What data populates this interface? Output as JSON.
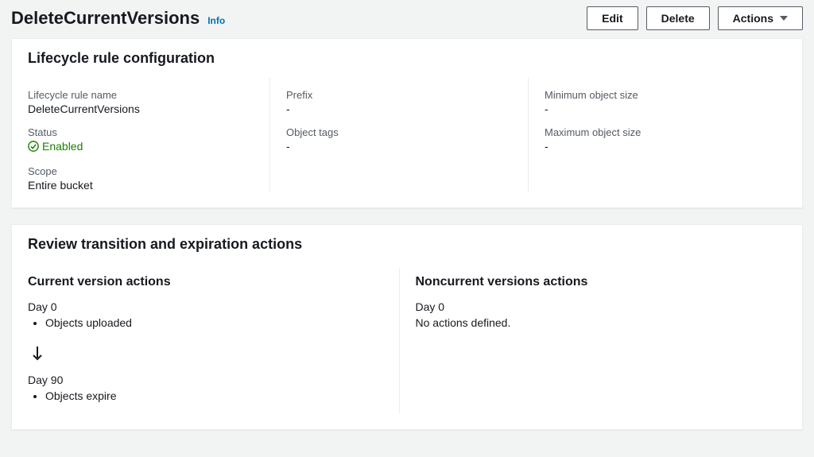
{
  "header": {
    "title": "DeleteCurrentVersions",
    "info": "Info",
    "buttons": {
      "edit": "Edit",
      "delete": "Delete",
      "actions": "Actions"
    }
  },
  "config": {
    "panel_title": "Lifecycle rule configuration",
    "col1": {
      "rule_name_label": "Lifecycle rule name",
      "rule_name_value": "DeleteCurrentVersions",
      "status_label": "Status",
      "status_value": "Enabled",
      "scope_label": "Scope",
      "scope_value": "Entire bucket"
    },
    "col2": {
      "prefix_label": "Prefix",
      "prefix_value": "-",
      "tags_label": "Object tags",
      "tags_value": "-"
    },
    "col3": {
      "min_label": "Minimum object size",
      "min_value": "-",
      "max_label": "Maximum object size",
      "max_value": "-"
    }
  },
  "review": {
    "panel_title": "Review transition and expiration actions",
    "current": {
      "heading": "Current version actions",
      "day0_label": "Day 0",
      "day0_item": "Objects uploaded",
      "day90_label": "Day 90",
      "day90_item": "Objects expire"
    },
    "noncurrent": {
      "heading": "Noncurrent versions actions",
      "day0_label": "Day 0",
      "none": "No actions defined."
    }
  }
}
